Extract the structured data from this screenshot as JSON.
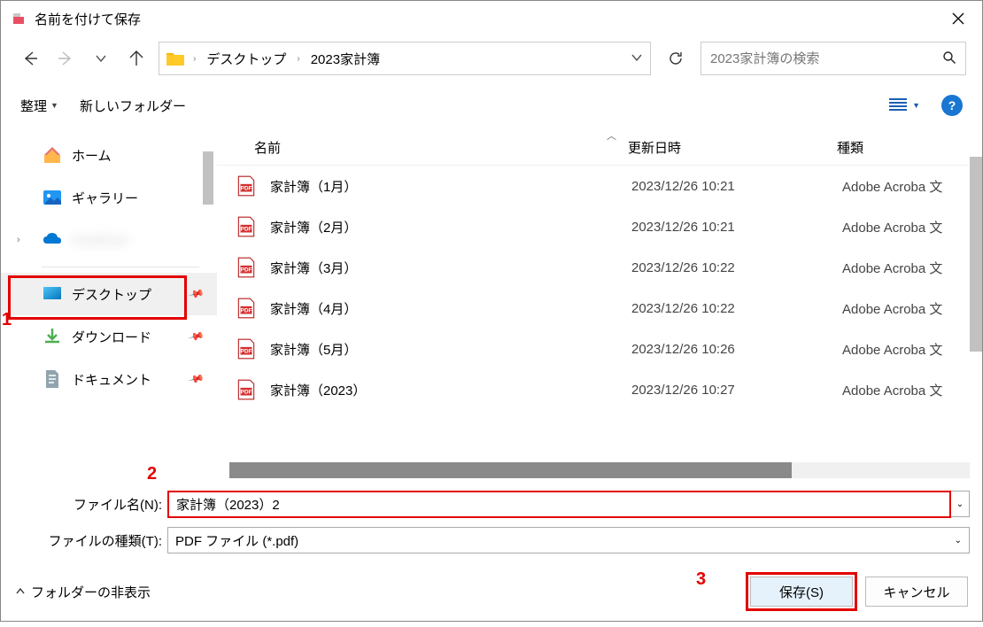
{
  "title": "名前を付けて保存",
  "breadcrumb": {
    "item1": "デスクトップ",
    "item2": "2023家計簿"
  },
  "search": {
    "placeholder": "2023家計簿の検索"
  },
  "toolbar": {
    "organize": "整理",
    "newfolder": "新しいフォルダー"
  },
  "sidebar": {
    "home": "ホーム",
    "gallery": "ギャラリー",
    "onedrive": "OneDrive",
    "desktop": "デスクトップ",
    "downloads": "ダウンロード",
    "documents": "ドキュメント"
  },
  "columns": {
    "name": "名前",
    "date": "更新日時",
    "type": "種類"
  },
  "files": [
    {
      "name": "家計簿（1月）",
      "date": "2023/12/26 10:21",
      "type": "Adobe Acroba 文"
    },
    {
      "name": "家計簿（2月）",
      "date": "2023/12/26 10:21",
      "type": "Adobe Acroba 文"
    },
    {
      "name": "家計簿（3月）",
      "date": "2023/12/26 10:22",
      "type": "Adobe Acroba 文"
    },
    {
      "name": "家計簿（4月）",
      "date": "2023/12/26 10:22",
      "type": "Adobe Acroba 文"
    },
    {
      "name": "家計簿（5月）",
      "date": "2023/12/26 10:26",
      "type": "Adobe Acroba 文"
    },
    {
      "name": "家計簿（2023）",
      "date": "2023/12/26 10:27",
      "type": "Adobe Acroba 文"
    }
  ],
  "save": {
    "filename_label": "ファイル名(N):",
    "filename_value": "家計簿（2023）2",
    "filetype_label": "ファイルの種類(T):",
    "filetype_value": "PDF ファイル (*.pdf)"
  },
  "bottom": {
    "folder_toggle": "フォルダーの非表示",
    "save_btn": "保存(S)",
    "cancel_btn": "キャンセル"
  },
  "annotations": {
    "a1": "1",
    "a2": "2",
    "a3": "3"
  }
}
